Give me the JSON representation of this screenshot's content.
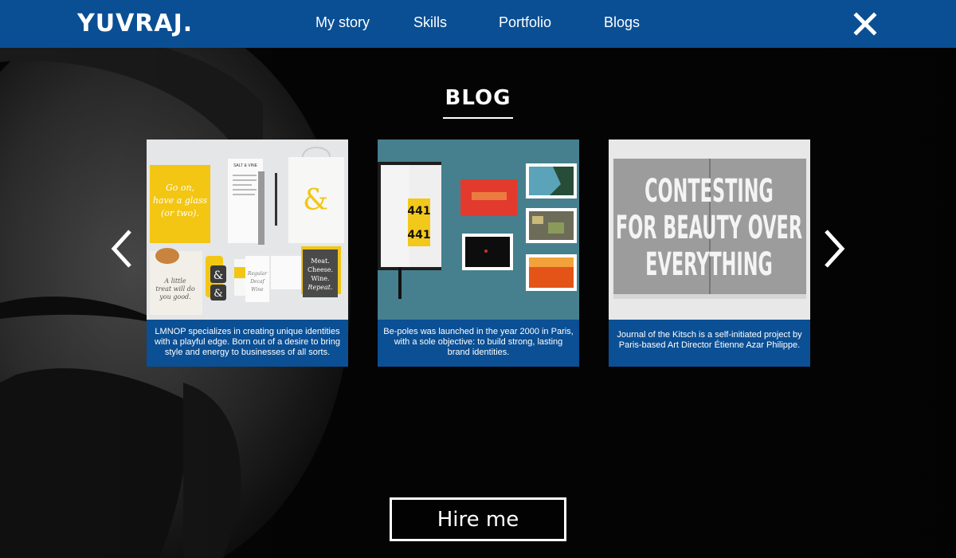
{
  "header": {
    "logo": "YUVRAJ.",
    "nav": [
      "My story",
      "Skills",
      "Portfolio",
      "Blogs"
    ],
    "close_icon": "close-icon"
  },
  "section": {
    "title": "BLOG"
  },
  "carousel": {
    "prev_icon": "chevron-left-icon",
    "next_icon": "chevron-right-icon",
    "cards": [
      {
        "caption": "LMNOP specializes in creating unique identities with a playful edge. Born out of a desire to bring style and energy to businesses of all sorts.",
        "thumb": {
          "card_text": "Go on, have a glass (or two).",
          "brand": "SALT & VINE",
          "ampersand": "&",
          "meat_card": "Meat. Cheese. Wine. Repeat.",
          "bag_text": "A little treat will do you good.",
          "cup_text": "Regular Decaf Wine"
        }
      },
      {
        "caption": "Be-poles was launched in the year 2000 in Paris, with a sole objective: to build strong, lasting brand identities.",
        "thumb": {
          "label_top": "441",
          "label_bottom": "441"
        }
      },
      {
        "caption": "Journal of the Kitsch is a self-initiated project by Paris-based Art Director Étienne Azar Philippe.",
        "thumb": {
          "headline": [
            "CONTESTING",
            "FOR BEAUTY OVER",
            "EVERYTHING"
          ]
        }
      }
    ]
  },
  "cta": {
    "label": "Hire me"
  },
  "colors": {
    "brand_blue": "#0a4f94",
    "background": "#000000",
    "text": "#ffffff"
  }
}
